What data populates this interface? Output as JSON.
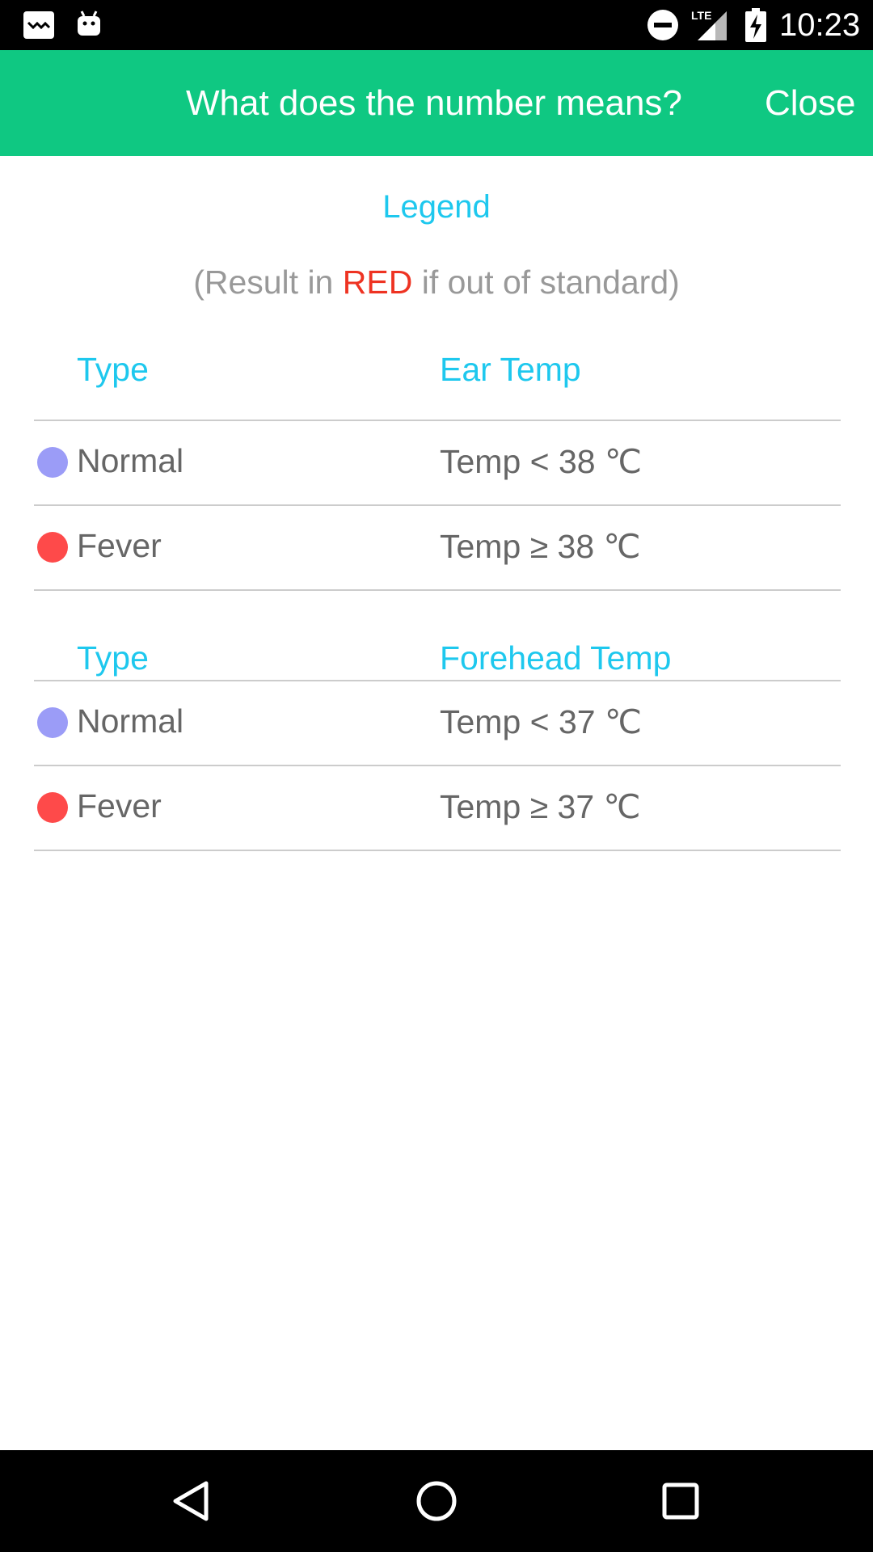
{
  "status_bar": {
    "time": "10:23",
    "icons": [
      "mail-icon",
      "android-icon",
      "do-not-disturb-icon",
      "lte-signal-icon",
      "battery-charging-icon"
    ]
  },
  "header": {
    "title": "What does the number means?",
    "close_label": "Close",
    "color": "#0fc882"
  },
  "legend": {
    "title": "Legend",
    "note_prefix": "(Result in ",
    "note_highlight": "RED",
    "note_suffix": " if out of standard)"
  },
  "tables": [
    {
      "headers": [
        "Type",
        "Ear Temp"
      ],
      "rows": [
        {
          "type": "Normal",
          "value": "Temp < 38 ℃",
          "dot_color": "#9b9cf7"
        },
        {
          "type": "Fever",
          "value": "Temp ≥ 38 ℃",
          "dot_color": "#fe4a4a"
        }
      ]
    },
    {
      "headers": [
        "Type",
        "Forehead Temp"
      ],
      "rows": [
        {
          "type": "Normal",
          "value": "Temp < 37 ℃",
          "dot_color": "#9b9cf7"
        },
        {
          "type": "Fever",
          "value": "Temp ≥ 37 ℃",
          "dot_color": "#fe4a4a"
        }
      ]
    }
  ],
  "nav_bar": {
    "icons": [
      "back-icon",
      "home-icon",
      "recents-icon"
    ]
  }
}
